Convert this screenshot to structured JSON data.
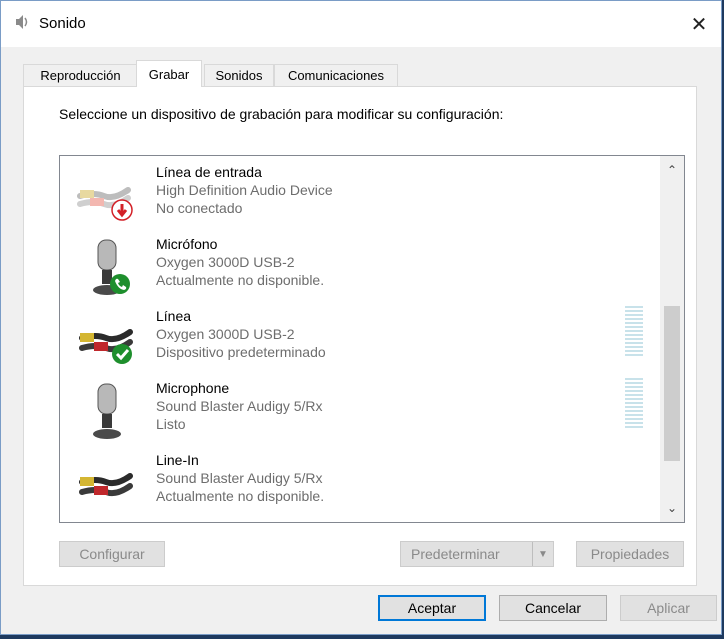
{
  "window": {
    "title": "Sonido",
    "close_label": "✕"
  },
  "tabs": [
    {
      "label": "Reproducción",
      "active": false
    },
    {
      "label": "Grabar",
      "active": true
    },
    {
      "label": "Sonidos",
      "active": false
    },
    {
      "label": "Comunicaciones",
      "active": false
    }
  ],
  "panel": {
    "prompt": "Seleccione un dispositivo de grabación para modificar su configuración:",
    "devices": [
      {
        "name": "Línea de entrada",
        "device": "High Definition Audio Device",
        "status": "No conectado",
        "icon": "line-in-disconnected-icon",
        "badge": "red-down-arrow"
      },
      {
        "name": "Micrófono",
        "device": "Oxygen 3000D USB-2",
        "status": "Actualmente no disponible.",
        "icon": "microphone-icon",
        "badge": "green-phone"
      },
      {
        "name": "Línea",
        "device": "Oxygen 3000D USB-2",
        "status": "Dispositivo predeterminado",
        "icon": "line-in-icon",
        "badge": "green-check",
        "level": 0
      },
      {
        "name": "Microphone",
        "device": "Sound Blaster Audigy 5/Rx",
        "status": "Listo",
        "icon": "microphone-icon",
        "level": 0
      },
      {
        "name": "Line-In",
        "device": "Sound Blaster Audigy 5/Rx",
        "status": "Actualmente no disponible.",
        "icon": "line-in-icon"
      }
    ]
  },
  "buttons": {
    "configure": "Configurar",
    "set_default": "Predeterminar",
    "properties": "Propiedades",
    "ok": "Aceptar",
    "cancel": "Cancelar",
    "apply": "Aplicar"
  },
  "colors": {
    "accent": "#0078d7",
    "green_badge": "#1e8f2d",
    "red_badge": "#d32027",
    "meter": "#c8e2ea"
  }
}
